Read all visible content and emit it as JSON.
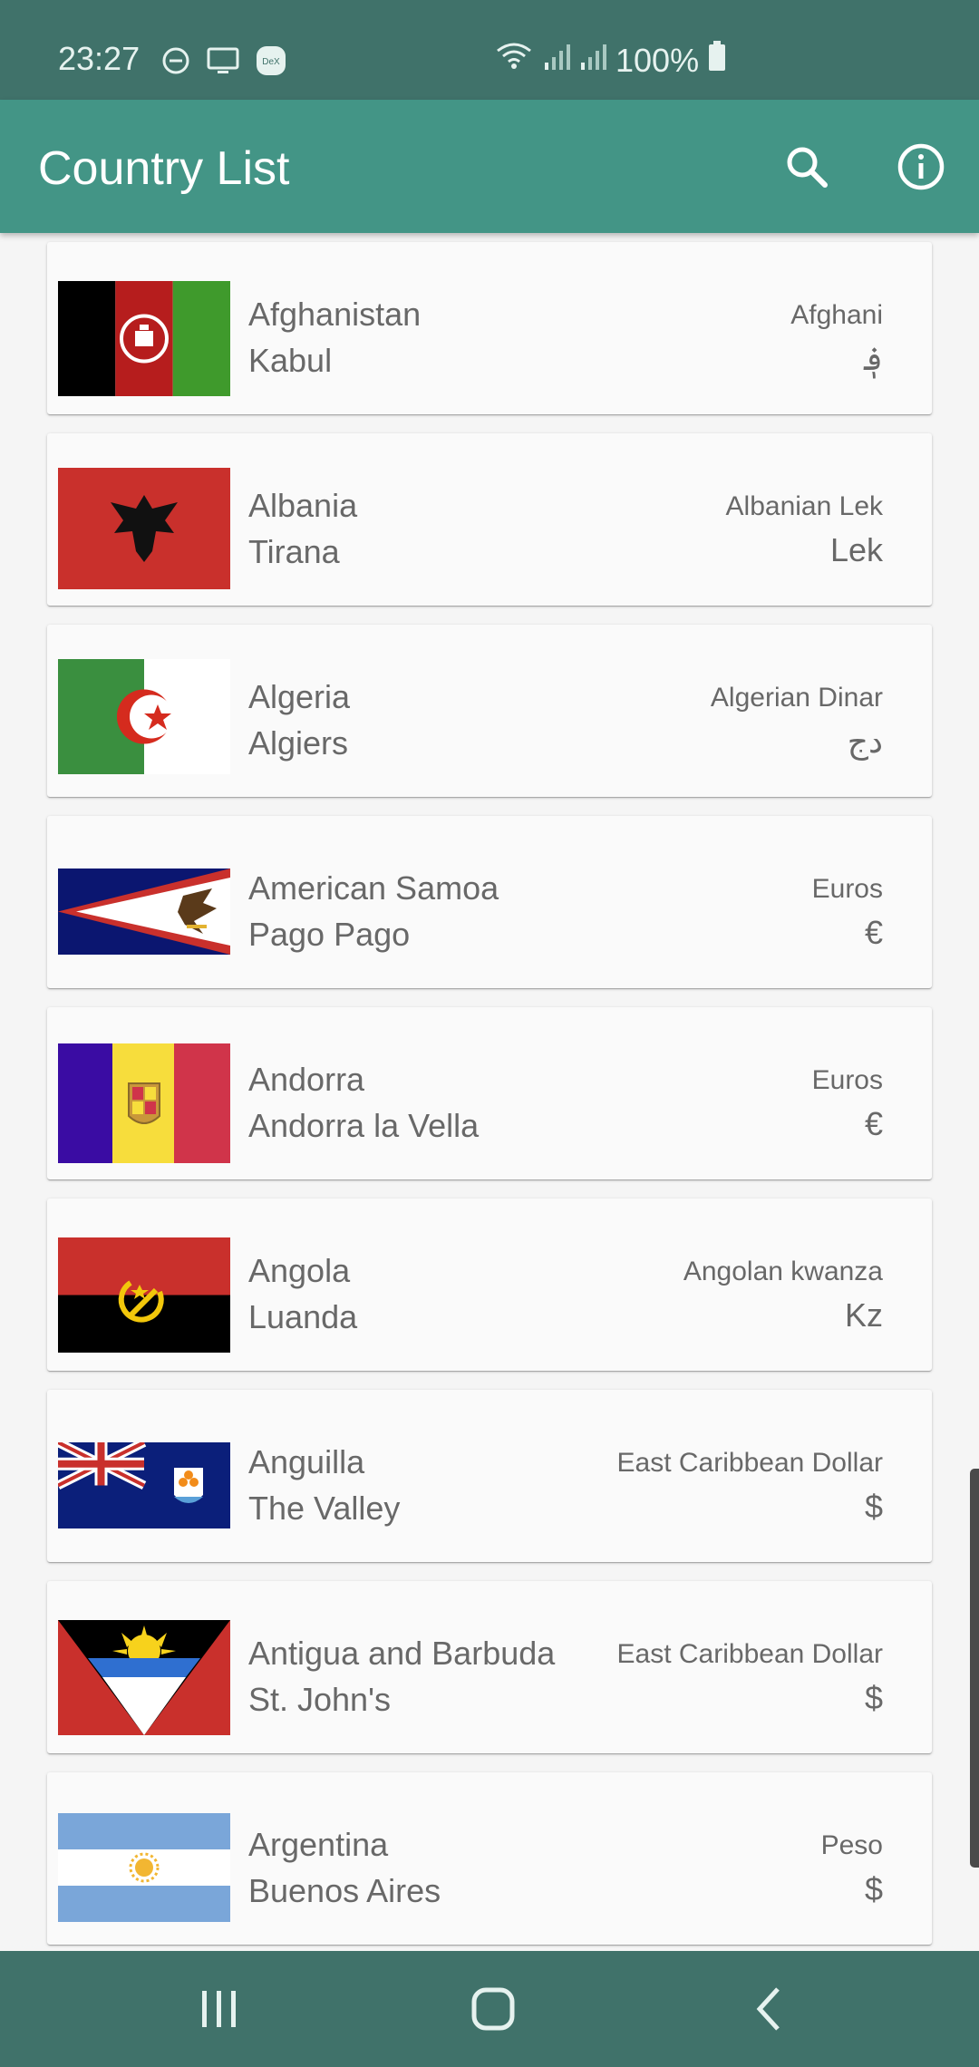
{
  "status_bar": {
    "time": "23:27",
    "battery": "100%",
    "icons": [
      "do-not-disturb-icon",
      "screen-cast-icon",
      "dex-icon",
      "wifi-icon",
      "signal-icon",
      "signal-icon",
      "battery-icon"
    ],
    "dex_label": "DeX"
  },
  "app_bar": {
    "title": "Country List",
    "actions": [
      "search-icon",
      "info-icon"
    ]
  },
  "countries": [
    {
      "name": "Afghanistan",
      "capital": "Kabul",
      "currency": "Afghani",
      "symbol": "؋"
    },
    {
      "name": "Albania",
      "capital": "Tirana",
      "currency": "Albanian Lek",
      "symbol": "Lek"
    },
    {
      "name": "Algeria",
      "capital": "Algiers",
      "currency": "Algerian Dinar",
      "symbol": "دج"
    },
    {
      "name": "American Samoa",
      "capital": "Pago Pago",
      "currency": "Euros",
      "symbol": "€"
    },
    {
      "name": "Andorra",
      "capital": "Andorra la Vella",
      "currency": "Euros",
      "symbol": "€"
    },
    {
      "name": "Angola",
      "capital": "Luanda",
      "currency": "Angolan kwanza",
      "symbol": "Kz"
    },
    {
      "name": "Anguilla",
      "capital": "The Valley",
      "currency": "East Caribbean Dollar",
      "symbol": "$"
    },
    {
      "name": "Antigua and Barbuda",
      "capital": "St. John's",
      "currency": "East Caribbean Dollar",
      "symbol": "$"
    },
    {
      "name": "Argentina",
      "capital": "Buenos Aires",
      "currency": "Peso",
      "symbol": "$"
    }
  ],
  "colors": {
    "status_bar": "#40726a",
    "app_bar": "#439586",
    "card": "#fafafa",
    "text": "#686868"
  },
  "nav_bar": {
    "buttons": [
      "recents-icon",
      "home-icon",
      "back-icon"
    ]
  }
}
